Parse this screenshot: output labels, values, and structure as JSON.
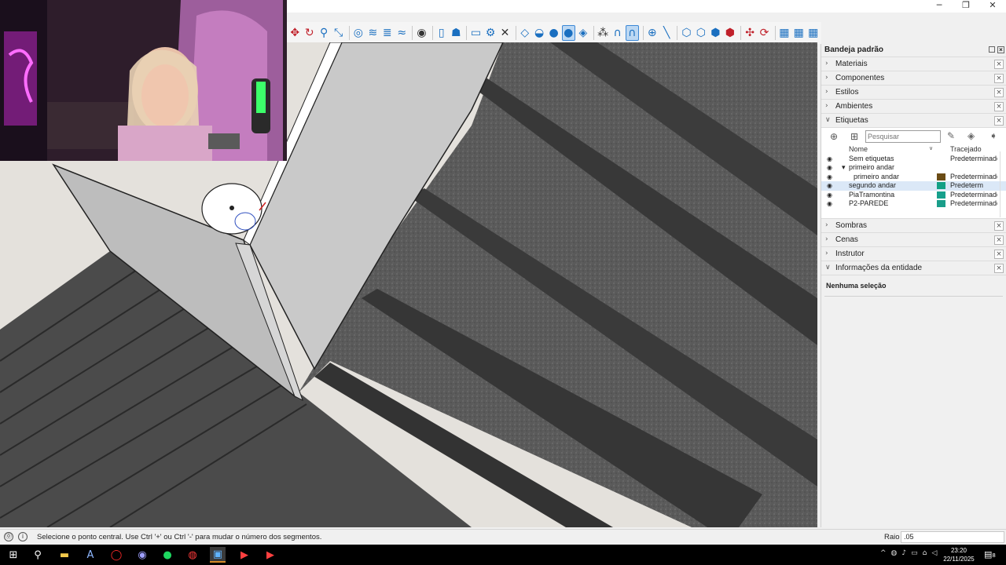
{
  "window": {
    "min": "─",
    "max": "❐",
    "close": "✕"
  },
  "toolbar": {
    "icons": [
      "move-icon",
      "rotate-icon",
      "zoom-icon",
      "zoom-extents-icon",
      "section-icon",
      "tag-icon",
      "layers-icon",
      "sandbox-icon",
      "styles-icon",
      "page-icon",
      "person-icon",
      "box-select-icon",
      "gear-icon",
      "close-icon",
      "drop-icon",
      "drop-half-icon",
      "drop-full-icon",
      "drop-active-icon",
      "drop-striped-icon",
      "magic-icon",
      "magnet-icon",
      "magnet-active-icon",
      "add-icon",
      "line-tool-icon",
      "cube-icon",
      "cube-outline-icon",
      "cube-solid-icon",
      "cube-red-icon",
      "explode-icon",
      "refresh-icon",
      "grid-icon",
      "grid2-icon",
      "grid3-icon"
    ]
  },
  "tray": {
    "title": "Bandeja padrão",
    "sections_top": [
      {
        "label": "Materiais",
        "name": "section-materiais"
      },
      {
        "label": "Componentes",
        "name": "section-componentes"
      },
      {
        "label": "Estilos",
        "name": "section-estilos"
      },
      {
        "label": "Ambientes",
        "name": "section-ambientes"
      }
    ],
    "tags": {
      "label": "Etiquetas",
      "search_placeholder": "Pesquisar",
      "col_name": "Nome",
      "col_dash": "Tracejado",
      "rows": [
        {
          "name": "Sem etiquetas",
          "indent": 0,
          "color": "",
          "dash": "Predeterminado"
        },
        {
          "name": "primeiro andar",
          "indent": 0,
          "color": "",
          "dash": "",
          "folder": true
        },
        {
          "name": "primeiro andar",
          "indent": 1,
          "color": "#6b4c15",
          "dash": "Predeterminado"
        },
        {
          "name": "segundo andar",
          "indent": 0,
          "color": "#13a085",
          "dash": "Predeterm",
          "selected": true
        },
        {
          "name": "PiaTramontina",
          "indent": 0,
          "color": "#16a08c",
          "dash": "Predeterminado"
        },
        {
          "name": "P2-PAREDE",
          "indent": 0,
          "color": "#1a9e8a",
          "dash": "Predeterminado"
        }
      ]
    },
    "sections_bottom": [
      {
        "label": "Sombras",
        "name": "section-sombras"
      },
      {
        "label": "Cenas",
        "name": "section-cenas"
      },
      {
        "label": "Instrutor",
        "name": "section-instrutor"
      }
    ],
    "entity": {
      "label": "Informações da entidade",
      "body": "Nenhuma seleção"
    }
  },
  "status": {
    "message": "Selecione o ponto central. Use Ctrl '+' ou Ctrl '-' para mudar o número dos segmentos.",
    "measure_label": "Raio",
    "measure_value": ".05"
  },
  "taskbar": {
    "time": "23:20",
    "date": "22/11/2025",
    "notif_count": "8"
  }
}
